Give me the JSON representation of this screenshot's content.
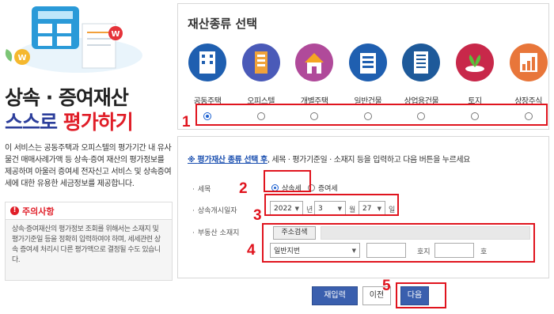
{
  "left": {
    "title_line1": "상속 · 증여재산",
    "title_line2_a": "스스로 ",
    "title_line2_b": "평가하기",
    "description": "이 서비스는 공동주택과 오피스텔의 평가기간 내 유사물건 매매사례가액 등 상속·증여 재산의 평가정보를 제공하며 아울러 증여세 전자신고 서비스 및 상속증여세에 대한 유용한 세금정보를 제공합니다.",
    "notice_title": "주의사항",
    "notice_body": "상속·증여재산의 평가정보 조회를 위해서는 소재지 및 평가기준일 등을 정확히 입력하여야 하며, 세세관련 상속 증여세 처리시 다른 평가액으로 결정될 수도 있습니다."
  },
  "top": {
    "title": "재산종류 선택",
    "assets": [
      {
        "label": "공동주택",
        "color": "#1f5fb0",
        "icon": "apartment-icon"
      },
      {
        "label": "오피스텔",
        "color": "#4a5ab8",
        "icon": "officetel-icon"
      },
      {
        "label": "개별주택",
        "color": "#b04a9a",
        "icon": "house-icon"
      },
      {
        "label": "일반건물",
        "color": "#1f5fb0",
        "icon": "building-icon"
      },
      {
        "label": "상업용건물",
        "color": "#1e5a9a",
        "icon": "commercial-building-icon"
      },
      {
        "label": "토지",
        "color": "#c8284a",
        "icon": "land-icon"
      },
      {
        "label": "상장주식",
        "color": "#e8763a",
        "icon": "stock-chart-icon"
      }
    ],
    "selected_asset": "공동주택"
  },
  "form": {
    "note_prefix": "※ ",
    "note_link": "평가재산 종류 선택 후",
    "note_rest": ", 세목 · 평가기준일 · 소재지 등을 입력하고 다음 버튼을 누르세요",
    "tax_label": "세목",
    "tax_option1": "상속세",
    "tax_option2": "증여세",
    "date_label": "상속개시일자",
    "year": "2022",
    "year_unit": "년",
    "month": "3",
    "month_unit": "월",
    "day": "27",
    "day_unit": "일",
    "addr_label": "부동산 소재지",
    "addr_search": "주소검색",
    "addr_type": "일반지번",
    "unit_1": "호지",
    "unit_2": "호"
  },
  "buttons": {
    "reset": "재입력",
    "prev": "이전",
    "next": "다음"
  },
  "annotations": [
    "1",
    "2",
    "3",
    "4",
    "5"
  ]
}
